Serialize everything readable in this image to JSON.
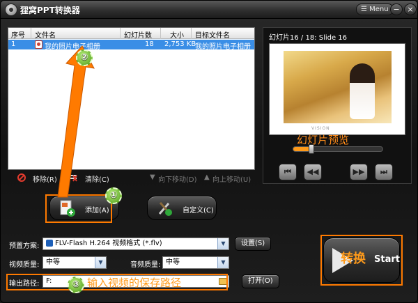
{
  "window": {
    "title": "狸窝PPT转换器",
    "menu_label": "Menu",
    "minimize_glyph": "−",
    "close_glyph": "×"
  },
  "file_list": {
    "columns": [
      "序号",
      "文件名",
      "幻灯片数",
      "大小",
      "目标文件名"
    ],
    "rows": [
      {
        "index": "1",
        "filename": "我的照片电子相册",
        "slides": "18",
        "size": "2,753 KB",
        "target": "我的照片电子相册"
      }
    ]
  },
  "list_toolbar": {
    "remove": "移除(R)",
    "clear": "清除(C)",
    "move_down": "向下移动(D)",
    "move_up": "向上移动(U)"
  },
  "preview": {
    "label": "幻灯片16 / 18: Slide 16",
    "photo_caption": "VISION",
    "progress": 0.2
  },
  "buttons": {
    "add": "添加(A)",
    "customize": "自定义(C)",
    "settings": "设置(S)",
    "open": "打开(O)",
    "convert_cn": "转换",
    "convert_en": "Start"
  },
  "settings": {
    "preset_label": "预置方案:",
    "preset_value": "FLV-Flash H.264 视频格式 (*.flv)",
    "video_quality_label": "视频质量:",
    "video_quality_value": "中等",
    "audio_quality_label": "音频质量:",
    "audio_quality_value": "中等",
    "output_label": "输出路径:",
    "output_value": "F:"
  },
  "annotations": {
    "badge1": "①",
    "badge2": "②",
    "badge3": "③",
    "preview_note": "幻灯片预览",
    "output_note": "输入视频的保存路径"
  },
  "colors": {
    "accent_orange": "#ff7a00",
    "selection_blue": "#3a8ee6"
  }
}
